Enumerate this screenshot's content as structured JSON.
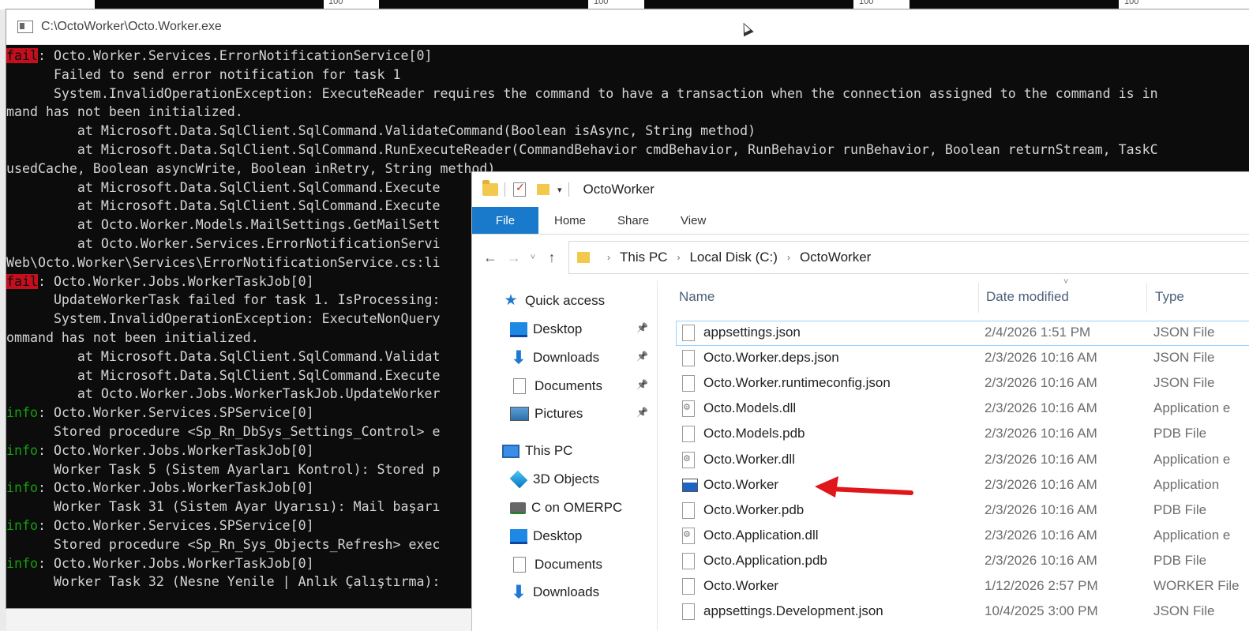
{
  "background": {
    "numbers": [
      "100",
      "100",
      "100",
      "100"
    ]
  },
  "console": {
    "title": "C:\\OctoWorker\\Octo.Worker.exe",
    "lines": [
      {
        "level": "fail",
        "text": ": Octo.Worker.Services.ErrorNotificationService[0]"
      },
      {
        "level": "",
        "text": "      Failed to send error notification for task 1"
      },
      {
        "level": "",
        "text": "      System.InvalidOperationException: ExecuteReader requires the command to have a transaction when the connection assigned to the command is in"
      },
      {
        "level": "",
        "text": "mand has not been initialized."
      },
      {
        "level": "",
        "text": "         at Microsoft.Data.SqlClient.SqlCommand.ValidateCommand(Boolean isAsync, String method)"
      },
      {
        "level": "",
        "text": "         at Microsoft.Data.SqlClient.SqlCommand.RunExecuteReader(CommandBehavior cmdBehavior, RunBehavior runBehavior, Boolean returnStream, TaskC"
      },
      {
        "level": "",
        "text": "usedCache, Boolean asyncWrite, Boolean inRetry, String method)"
      },
      {
        "level": "",
        "text": "         at Microsoft.Data.SqlClient.SqlCommand.Execute"
      },
      {
        "level": "",
        "text": "         at Microsoft.Data.SqlClient.SqlCommand.Execute"
      },
      {
        "level": "",
        "text": "         at Octo.Worker.Models.MailSettings.GetMailSett"
      },
      {
        "level": "",
        "text": "         at Octo.Worker.Services.ErrorNotificationServi"
      },
      {
        "level": "",
        "text": "Web\\Octo.Worker\\Services\\ErrorNotificationService.cs:li"
      },
      {
        "level": "fail",
        "text": ": Octo.Worker.Jobs.WorkerTaskJob[0]"
      },
      {
        "level": "",
        "text": "      UpdateWorkerTask failed for task 1. IsProcessing:"
      },
      {
        "level": "",
        "text": "      System.InvalidOperationException: ExecuteNonQuery"
      },
      {
        "level": "",
        "text": "ommand has not been initialized."
      },
      {
        "level": "",
        "text": "         at Microsoft.Data.SqlClient.SqlCommand.Validat"
      },
      {
        "level": "",
        "text": "         at Microsoft.Data.SqlClient.SqlCommand.Execute"
      },
      {
        "level": "",
        "text": "         at Octo.Worker.Jobs.WorkerTaskJob.UpdateWorker"
      },
      {
        "level": "info",
        "text": ": Octo.Worker.Services.SPService[0]"
      },
      {
        "level": "",
        "text": "      Stored procedure <Sp_Rn_DbSys_Settings_Control> e"
      },
      {
        "level": "info",
        "text": ": Octo.Worker.Jobs.WorkerTaskJob[0]"
      },
      {
        "level": "",
        "text": "      Worker Task 5 (Sistem Ayarları Kontrol): Stored p"
      },
      {
        "level": "info",
        "text": ": Octo.Worker.Jobs.WorkerTaskJob[0]"
      },
      {
        "level": "",
        "text": "      Worker Task 31 (Sistem Ayar Uyarısı): Mail başarı"
      },
      {
        "level": "info",
        "text": ": Octo.Worker.Services.SPService[0]"
      },
      {
        "level": "",
        "text": "      Stored procedure <Sp_Rn_Sys_Objects_Refresh> exec"
      },
      {
        "level": "info",
        "text": ": Octo.Worker.Jobs.WorkerTaskJob[0]"
      },
      {
        "level": "",
        "text": "      Worker Task 32 (Nesne Yenile | Anlık Çalıştırma):"
      }
    ]
  },
  "explorer": {
    "title": "OctoWorker",
    "ribbon_tabs": [
      "File",
      "Home",
      "Share",
      "View"
    ],
    "breadcrumb": [
      "This PC",
      "Local Disk (C:)",
      "OctoWorker"
    ],
    "nav_items": [
      {
        "label": "Quick access",
        "icon": "star-icon",
        "pinned": false,
        "indent": false
      },
      {
        "label": "Desktop",
        "icon": "desktop-icon",
        "pinned": true,
        "indent": true
      },
      {
        "label": "Downloads",
        "icon": "downloads-icon",
        "pinned": true,
        "indent": true
      },
      {
        "label": "Documents",
        "icon": "documents-icon",
        "pinned": true,
        "indent": true
      },
      {
        "label": "Pictures",
        "icon": "pictures-icon",
        "pinned": true,
        "indent": true
      },
      {
        "label": "This PC",
        "icon": "computer-icon",
        "pinned": false,
        "indent": false
      },
      {
        "label": "3D Objects",
        "icon": "3d-objects-icon",
        "pinned": false,
        "indent": true
      },
      {
        "label": "C on OMERPC",
        "icon": "network-drive-icon",
        "pinned": false,
        "indent": true
      },
      {
        "label": "Desktop",
        "icon": "desktop-icon",
        "pinned": false,
        "indent": true
      },
      {
        "label": "Documents",
        "icon": "documents-icon",
        "pinned": false,
        "indent": true
      },
      {
        "label": "Downloads",
        "icon": "downloads-icon",
        "pinned": false,
        "indent": true
      }
    ],
    "columns": [
      "Name",
      "Date modified",
      "Type"
    ],
    "files": [
      {
        "name": "appsettings.json",
        "date": "2/4/2026 1:51 PM",
        "type": "JSON File",
        "kind": "file",
        "selected": true
      },
      {
        "name": "Octo.Worker.deps.json",
        "date": "2/3/2026 10:16 AM",
        "type": "JSON File",
        "kind": "file",
        "selected": false
      },
      {
        "name": "Octo.Worker.runtimeconfig.json",
        "date": "2/3/2026 10:16 AM",
        "type": "JSON File",
        "kind": "file",
        "selected": false
      },
      {
        "name": "Octo.Models.dll",
        "date": "2/3/2026 10:16 AM",
        "type": "Application e",
        "kind": "dll",
        "selected": false
      },
      {
        "name": "Octo.Models.pdb",
        "date": "2/3/2026 10:16 AM",
        "type": "PDB File",
        "kind": "file",
        "selected": false
      },
      {
        "name": "Octo.Worker.dll",
        "date": "2/3/2026 10:16 AM",
        "type": "Application e",
        "kind": "dll",
        "selected": false
      },
      {
        "name": "Octo.Worker",
        "date": "2/3/2026 10:16 AM",
        "type": "Application",
        "kind": "exe",
        "selected": false
      },
      {
        "name": "Octo.Worker.pdb",
        "date": "2/3/2026 10:16 AM",
        "type": "PDB File",
        "kind": "file",
        "selected": false
      },
      {
        "name": "Octo.Application.dll",
        "date": "2/3/2026 10:16 AM",
        "type": "Application e",
        "kind": "dll",
        "selected": false
      },
      {
        "name": "Octo.Application.pdb",
        "date": "2/3/2026 10:16 AM",
        "type": "PDB File",
        "kind": "file",
        "selected": false
      },
      {
        "name": "Octo.Worker",
        "date": "1/12/2026 2:57 PM",
        "type": "WORKER File",
        "kind": "file",
        "selected": false
      },
      {
        "name": "appsettings.Development.json",
        "date": "10/4/2025 3:00 PM",
        "type": "JSON File",
        "kind": "file",
        "selected": false
      }
    ]
  },
  "annotation": {
    "arrow_color": "#e0161b"
  }
}
